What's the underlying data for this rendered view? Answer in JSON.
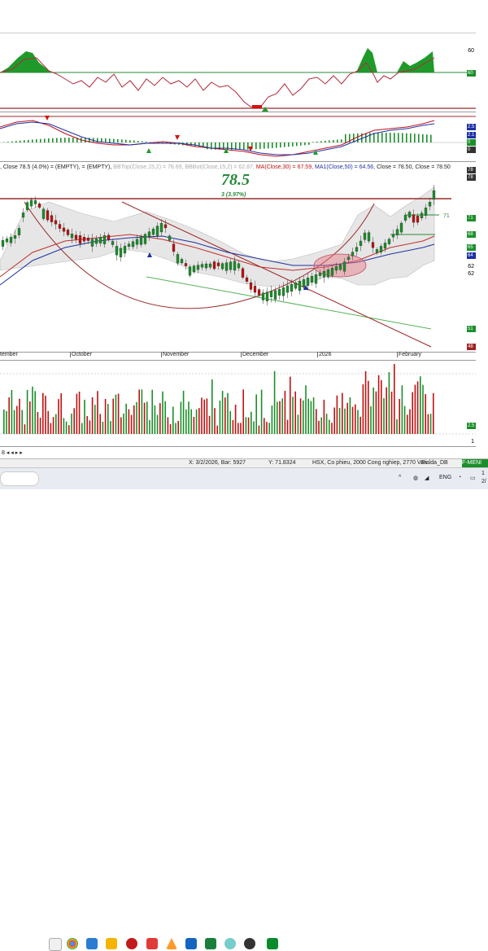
{
  "panel_main": {
    "legend": ", Close 78.5 (4.0%)   = (EMPTY),   = (EMPTY),",
    "bb_top_label": "BBTop(Close,15,2) = 78.69,",
    "bb_bot_label": "BBBot(Close,15,2) = 62.87,",
    "ma30_label": "MA(Close,30) = 67.59,",
    "ma50_label": "MA1(Close,50) = 64.56,",
    "close_label": "Close = 78.50,  Close = 78.50",
    "big_price": "78.5",
    "change_text": "3 (3.97%)",
    "level_71": "71"
  },
  "x_axis": [
    "tember",
    "October",
    "November",
    "December",
    "2026",
    "February"
  ],
  "right_axis": {
    "top_panel": [
      "60",
      "60"
    ],
    "macd_panel": [
      "2.5",
      "2.1",
      "0",
      "0"
    ],
    "main_panel": [
      "78",
      "78",
      "71",
      "68",
      "65",
      "64",
      "62",
      "62",
      "51",
      "48"
    ],
    "volume_panel": [
      "2.5",
      "1"
    ]
  },
  "status_bar": {
    "coords": "X: 3/2/2026, Bar: 5927",
    "y_value": "Y: 71.8324",
    "info": "HSX, Co phieu, 2000 Cong nghiep, 2770 Van",
    "user": "Fialda_DB",
    "menu": "F-MENI"
  },
  "taskbar": {
    "search_placeholder": "",
    "lang": "ENG",
    "time": "1",
    "date": "2/"
  },
  "colors": {
    "up": "#1a8f2a",
    "down": "#c01010",
    "accent_green": "#2a8a3a",
    "resistance": "#9b2a2a"
  },
  "chart_data": {
    "type": "candlestick",
    "title": "",
    "last_close": 78.5,
    "change_pct": 3.97,
    "x_labels": [
      "tember",
      "October",
      "November",
      "December",
      "2026",
      "February"
    ],
    "indicators": {
      "bb_top": 78.69,
      "bb_bot": 62.87,
      "ma30": 67.59,
      "ma50": 64.56
    },
    "ylim": [
      45,
      80
    ]
  }
}
